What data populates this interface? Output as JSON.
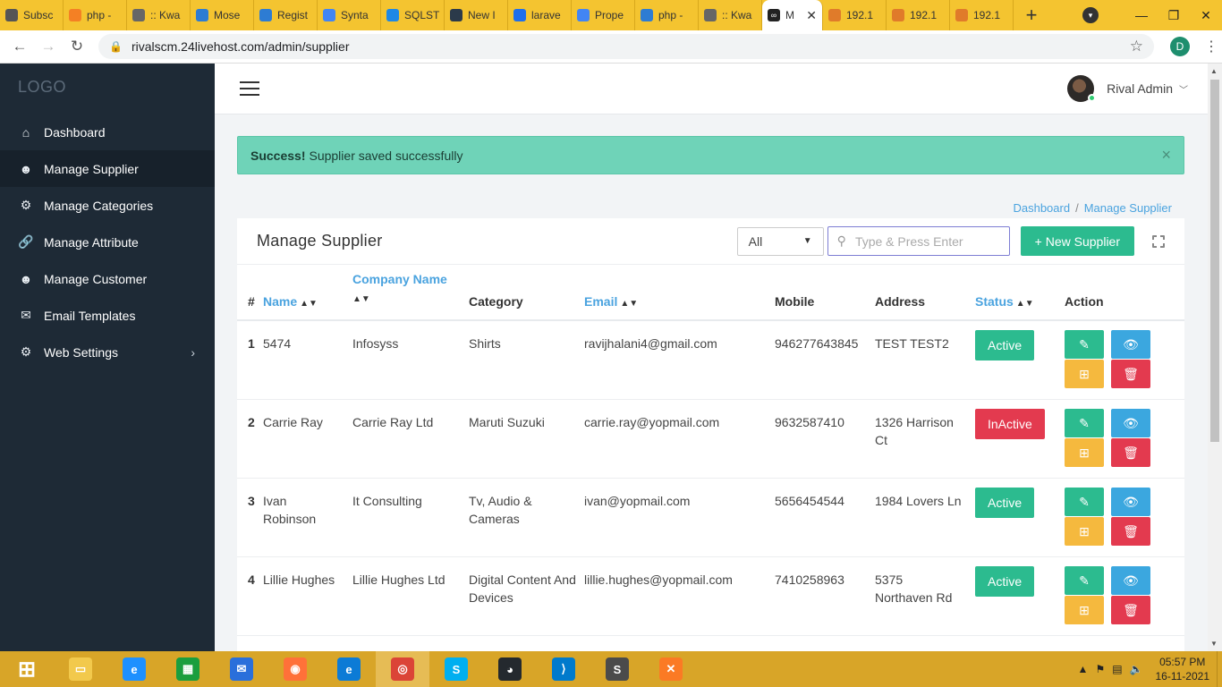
{
  "browser": {
    "tabs": [
      {
        "label": "Subsc",
        "icon": "loading-icon",
        "color": "#555555"
      },
      {
        "label": "php -",
        "icon": "stackoverflow-icon",
        "color": "#f48024"
      },
      {
        "label": ":: Kwa",
        "icon": "globe-icon",
        "color": "#666666"
      },
      {
        "label": "Mose",
        "icon": "bookmark-icon",
        "color": "#2d7cd3"
      },
      {
        "label": "Regist",
        "icon": "bookmark-icon",
        "color": "#2d7cd3"
      },
      {
        "label": "Synta",
        "icon": "google-icon",
        "color": "#4285f4"
      },
      {
        "label": "SQLST",
        "icon": "sql-icon",
        "color": "#1e88e5"
      },
      {
        "label": "New I",
        "icon": "app-icon",
        "color": "#2b3a4a"
      },
      {
        "label": "larave",
        "icon": "laravel-icon",
        "color": "#1f6feb"
      },
      {
        "label": "Prope",
        "icon": "google-icon",
        "color": "#4285f4"
      },
      {
        "label": "php -",
        "icon": "php-icon",
        "color": "#2d7cd3"
      },
      {
        "label": ":: Kwa",
        "icon": "globe-icon",
        "color": "#666666"
      }
    ],
    "active_tab": {
      "label": "M",
      "icon": "infinity-icon"
    },
    "trailing_tabs": [
      {
        "label": "192.1",
        "icon": "pma-icon"
      },
      {
        "label": "192.1",
        "icon": "pma-icon"
      },
      {
        "label": "192.1",
        "icon": "pma-icon"
      }
    ],
    "url": "rivalscm.24livehost.com/admin/supplier",
    "profile_initial": "D"
  },
  "sidebar": {
    "logo": "LOGO",
    "items": [
      {
        "label": "Dashboard",
        "icon": "home-icon"
      },
      {
        "label": "Manage Supplier",
        "icon": "user-icon"
      },
      {
        "label": "Manage Categories",
        "icon": "gears-icon"
      },
      {
        "label": "Manage Attribute",
        "icon": "link-icon"
      },
      {
        "label": "Manage Customer",
        "icon": "user-icon"
      },
      {
        "label": "Email Templates",
        "icon": "mail-icon"
      },
      {
        "label": "Web Settings",
        "icon": "gears-icon"
      }
    ]
  },
  "header": {
    "user_name": "Rival Admin"
  },
  "alert": {
    "strong": "Success!",
    "message": "Supplier saved successfully",
    "close": "×"
  },
  "breadcrumb": {
    "home": "Dashboard",
    "separator": "/",
    "current": "Manage Supplier"
  },
  "card": {
    "title": "Manage Supplier",
    "filter_value": "All",
    "search_placeholder": "Type & Press Enter",
    "new_button": "+ New Supplier"
  },
  "table": {
    "headers": {
      "num": "#",
      "name": "Name",
      "company_line1": "Company Name",
      "category": "Category",
      "email": "Email",
      "mobile": "Mobile",
      "address": "Address",
      "status": "Status",
      "action": "Action"
    },
    "rows": [
      {
        "num": "1",
        "name": "5474",
        "company": "Infosyss",
        "category": "Shirts",
        "email": "ravijhalani4@gmail.com",
        "mobile": "946277643845",
        "address": "TEST TEST2",
        "status": "Active"
      },
      {
        "num": "2",
        "name": "Carrie Ray",
        "company": "Carrie Ray Ltd",
        "category": "Maruti Suzuki",
        "email": "carrie.ray@yopmail.com",
        "mobile": "9632587410",
        "address": "1326 Harrison Ct",
        "status": "InActive"
      },
      {
        "num": "3",
        "name": "Ivan Robinson",
        "company": "It Consulting",
        "category": "Tv, Audio & Cameras",
        "email": "ivan@yopmail.com",
        "mobile": "5656454544",
        "address": "1984 Lovers Ln",
        "status": "Active"
      },
      {
        "num": "4",
        "name": "Lillie Hughes",
        "company": "Lillie Hughes Ltd",
        "category": "Digital Content And Devices",
        "email": "lillie.hughes@yopmail.com",
        "mobile": "7410258963",
        "address": "5375 Northaven Rd",
        "status": "Active"
      }
    ]
  },
  "taskbar": {
    "time": "05:57 PM",
    "date": "16-11-2021",
    "apps": [
      {
        "icon": "windows-start-icon",
        "color": "#ffffff"
      },
      {
        "icon": "file-explorer-icon",
        "color": "#f2c94c"
      },
      {
        "icon": "internet-explorer-icon",
        "color": "#1e90ff"
      },
      {
        "icon": "store-icon",
        "color": "#1b9e3e"
      },
      {
        "icon": "thunderbird-icon",
        "color": "#2a6fdb"
      },
      {
        "icon": "firefox-icon",
        "color": "#ff7139"
      },
      {
        "icon": "edge-icon",
        "color": "#0c7bd6"
      },
      {
        "icon": "chrome-icon",
        "color": "#db4437"
      },
      {
        "icon": "skype-icon",
        "color": "#00aff0"
      },
      {
        "icon": "github-icon",
        "color": "#24292e"
      },
      {
        "icon": "vscode-icon",
        "color": "#007acc"
      },
      {
        "icon": "sublime-icon",
        "color": "#4b4b4b"
      },
      {
        "icon": "xampp-icon",
        "color": "#fb7a24"
      }
    ]
  }
}
